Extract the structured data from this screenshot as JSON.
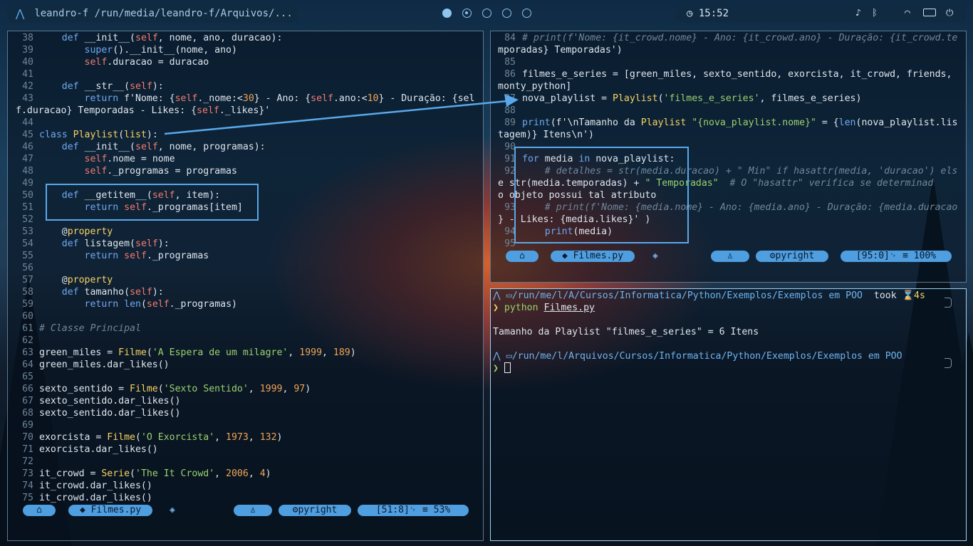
{
  "topbar": {
    "path": "leandro-f /run/media/leandro-f/Arquivos/...",
    "time": "15:52",
    "workspaces": 5,
    "tray_icons": [
      "media-icon",
      "bluetooth-icon",
      "wifi-icon",
      "battery-icon",
      "power-icon"
    ]
  },
  "editor_left": {
    "lines": [
      {
        "n": "38",
        "code": "    def __init__(self, nome, ano, duracao):"
      },
      {
        "n": "39",
        "code": "        super().__init__(nome, ano)"
      },
      {
        "n": "40",
        "code": "        self.duracao = duracao"
      },
      {
        "n": "41",
        "code": ""
      },
      {
        "n": "42",
        "code": "    def __str__(self):"
      },
      {
        "n": "43",
        "code": "        return f'Nome: {self._nome:<30} - Ano: {self.ano:<10} - Duração: {sel"
      },
      {
        "n": "",
        "code": "f.duracao} Temporadas - Likes: {self._likes}'"
      },
      {
        "n": "44",
        "code": ""
      },
      {
        "n": "45",
        "code": "class Playlist(list):"
      },
      {
        "n": "46",
        "code": "    def __init__(self, nome, programas):"
      },
      {
        "n": "47",
        "code": "        self.nome = nome"
      },
      {
        "n": "48",
        "code": "        self._programas = programas"
      },
      {
        "n": "49",
        "code": ""
      },
      {
        "n": "50",
        "code": "    def __getitem__(self, item):"
      },
      {
        "n": "51",
        "code": "        return self._programas[item]"
      },
      {
        "n": "52",
        "code": ""
      },
      {
        "n": "53",
        "code": "    @property"
      },
      {
        "n": "54",
        "code": "    def listagem(self):"
      },
      {
        "n": "55",
        "code": "        return self._programas"
      },
      {
        "n": "56",
        "code": ""
      },
      {
        "n": "57",
        "code": "    @property"
      },
      {
        "n": "58",
        "code": "    def tamanho(self):"
      },
      {
        "n": "59",
        "code": "        return len(self._programas)"
      },
      {
        "n": "60",
        "code": ""
      },
      {
        "n": "61",
        "code": "# Classe Principal"
      },
      {
        "n": "62",
        "code": ""
      },
      {
        "n": "63",
        "code": "green_miles = Filme('A Espera de um milagre', 1999, 189)"
      },
      {
        "n": "64",
        "code": "green_miles.dar_likes()"
      },
      {
        "n": "65",
        "code": ""
      },
      {
        "n": "66",
        "code": "sexto_sentido = Filme('Sexto Sentido', 1999, 97)"
      },
      {
        "n": "67",
        "code": "sexto_sentido.dar_likes()"
      },
      {
        "n": "68",
        "code": "sexto_sentido.dar_likes()"
      },
      {
        "n": "69",
        "code": ""
      },
      {
        "n": "70",
        "code": "exorcista = Filme('O Exorcista', 1973, 132)"
      },
      {
        "n": "71",
        "code": "exorcista.dar_likes()"
      },
      {
        "n": "72",
        "code": ""
      },
      {
        "n": "73",
        "code": "it_crowd = Serie('The It Crowd', 2006, 4)"
      },
      {
        "n": "74",
        "code": "it_crowd.dar_likes()"
      },
      {
        "n": "75",
        "code": "it_crowd.dar_likes()"
      }
    ],
    "statusline": {
      "file": "Filmes.py",
      "lsp": "pyright",
      "position": "[51:8]␊ ≡ 53%"
    }
  },
  "editor_right": {
    "lines": [
      {
        "n": "84",
        "code": "# print(f'Nome: {it_crowd.nome} - Ano: {it_crowd.ano} - Duração: {it_crowd.te"
      },
      {
        "n": "",
        "code": "mporadas} Temporadas')"
      },
      {
        "n": "85",
        "code": ""
      },
      {
        "n": "86",
        "code": "filmes_e_series = [green_miles, sexto_sentido, exorcista, it_crowd, friends,"
      },
      {
        "n": "",
        "code": "monty_python]"
      },
      {
        "n": "87",
        "code": "nova_playlist = Playlist('filmes_e_series', filmes_e_series)"
      },
      {
        "n": "88",
        "code": ""
      },
      {
        "n": "89",
        "code": "print(f'\\nTamanho da Playlist \"{nova_playlist.nome}\" = {len(nova_playlist.lis"
      },
      {
        "n": "",
        "code": "tagem)} Itens\\n')"
      },
      {
        "n": "90",
        "code": ""
      },
      {
        "n": "91",
        "code": "for media in nova_playlist:"
      },
      {
        "n": "92",
        "code": "    # detalhes = str(media.duracao) + \" Min\" if hasattr(media, 'duracao') els"
      },
      {
        "n": "",
        "code": "e str(media.temporadas) + \" Temporadas\"  # O \"hasattr\" verifica se determinad"
      },
      {
        "n": "",
        "code": "o objeto possui tal atributo"
      },
      {
        "n": "93",
        "code": "    # print(f'Nome: {media.nome} - Ano: {media.ano} - Duração: {media.duracao"
      },
      {
        "n": "",
        "code": "} - Likes: {media.likes}' )"
      },
      {
        "n": "94",
        "code": "    print(media)"
      },
      {
        "n": "95",
        "code": ""
      }
    ],
    "statusline": {
      "file": "Filmes.py",
      "lsp": "pyright",
      "position": "[95:0]␊ ≡ 100%"
    }
  },
  "terminal": {
    "prompt1_path": "/run/me/l/A/Cursos/Informatica/Python/Exemplos/Exemplos em POO",
    "took_label": "took",
    "took_value": "4s",
    "command": "python",
    "command_arg": "Filmes.py",
    "output": "Tamanho da Playlist \"filmes_e_series\" = 6 Itens",
    "prompt2_path": "/run/me/l/Arquivos/Cursos/Informatica/Python/Exemplos/Exemplos em POO"
  }
}
